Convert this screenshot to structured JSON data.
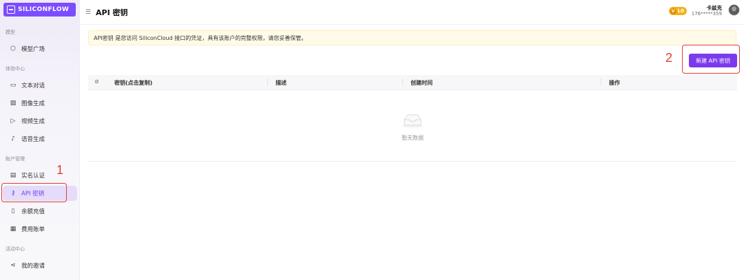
{
  "brand": {
    "name": "SILICONFLOW",
    "color": "#7c3aed"
  },
  "sidebar": {
    "groups": [
      {
        "title": "模型",
        "items": [
          {
            "label": "模型广场",
            "icon": "cube-icon"
          }
        ]
      },
      {
        "title": "体验中心",
        "items": [
          {
            "label": "文本对话",
            "icon": "chat-icon"
          },
          {
            "label": "图像生成",
            "icon": "image-icon"
          },
          {
            "label": "视频生成",
            "icon": "video-icon"
          },
          {
            "label": "语音生成",
            "icon": "mic-icon"
          }
        ]
      },
      {
        "title": "账户管理",
        "items": [
          {
            "label": "实名认证",
            "icon": "id-card-icon"
          },
          {
            "label": "API 密钥",
            "icon": "key-icon",
            "active": true
          },
          {
            "label": "余额充值",
            "icon": "recharge-icon"
          },
          {
            "label": "费用账单",
            "icon": "bill-icon"
          }
        ]
      },
      {
        "title": "活动中心",
        "items": [
          {
            "label": "我的邀请",
            "icon": "share-icon"
          }
        ]
      }
    ]
  },
  "header": {
    "title": "API 密钥",
    "level": "L0",
    "user_name": "卡兹克",
    "user_phone": "176*****359"
  },
  "notice": "API密钥 是您访问 SiliconCloud 接口的凭证，具有该账户的完整权限，请您妥善保管。",
  "create_button": "新建 API 密钥",
  "table": {
    "columns": [
      "密钥(点击复制)",
      "描述",
      "创建时间",
      "操作"
    ],
    "empty_text": "暂无数据"
  },
  "annotations": [
    "1",
    "2"
  ],
  "colors": {
    "annotation": "#e23d2e",
    "active_bg": "#e5dcfa",
    "notice_bg": "#fffbe8",
    "level_badge": "#f2b21c"
  }
}
